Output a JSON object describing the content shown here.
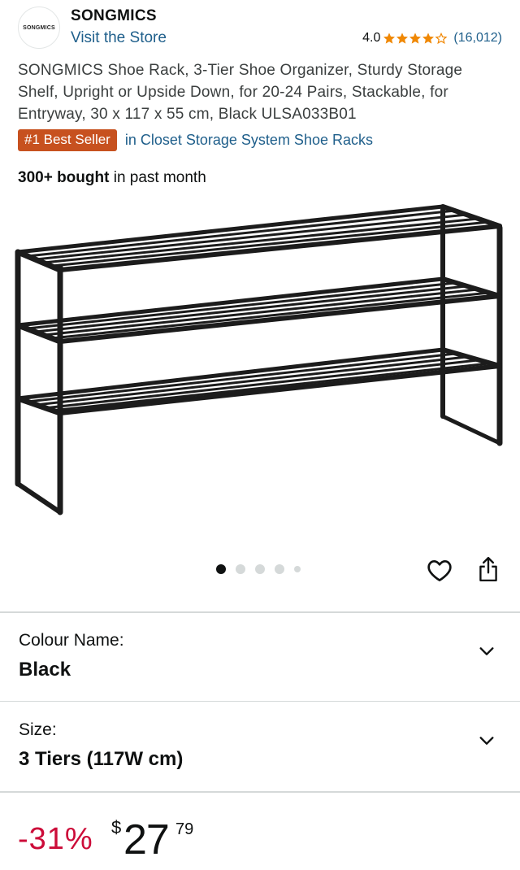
{
  "store": {
    "logo_text": "SONGMICS",
    "brand_name": "SONGMICS",
    "visit_store_label": "Visit the Store",
    "rating": "4.0",
    "rating_stars": 4,
    "rating_count": "(16,012)"
  },
  "product": {
    "title": "SONGMICS Shoe Rack, 3-Tier Shoe Organizer, Sturdy Storage Shelf, Upright or Upside Down, for 20-24 Pairs, Stackable, for Entryway, 30 x 117 x 55 cm, Black ULSA033B01",
    "badge": "#1 Best Seller",
    "badge_category": "in Closet Storage System Shoe Racks",
    "bought_count": "300+ bought",
    "bought_suffix": " in past month",
    "image_count": 5,
    "active_image": 0
  },
  "actions": {
    "wishlist_icon": "heart-icon",
    "share_icon": "share-icon"
  },
  "options": {
    "colour_label": "Colour Name:",
    "colour_value": "Black",
    "size_label": "Size:",
    "size_value": "3 Tiers (117W cm)"
  },
  "price": {
    "discount": "-31%",
    "currency": "$",
    "whole": "27",
    "fraction": "79"
  },
  "colors": {
    "link": "#1f5f8b",
    "badge": "#c7511f",
    "star": "#f08804",
    "discount": "#cc0c39"
  }
}
